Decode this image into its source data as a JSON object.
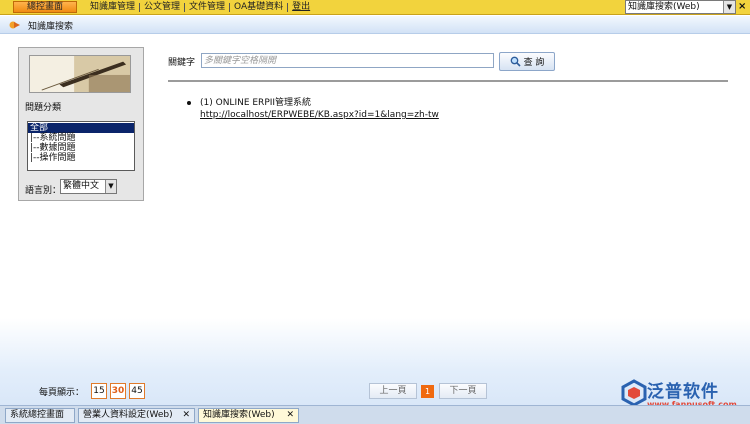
{
  "topbar": {
    "home_label": "總控畫面",
    "menu": [
      "知識庫管理",
      "公文管理",
      "文件管理",
      "OA基礎資料"
    ],
    "logout_label": "登出",
    "module_select_value": "知識庫搜索(Web)",
    "close_symbol": "×"
  },
  "header": {
    "title": "知識庫搜索"
  },
  "left_panel": {
    "category_label": "問題分類",
    "categories": [
      "全部",
      "|--系統問題",
      "|--數據問題",
      "|--操作問題"
    ],
    "selected_category": "全部",
    "language_label": "語言別：",
    "language_value": "繁體中文"
  },
  "search": {
    "keyword_label": "關鍵字",
    "placeholder": "多關鍵字空格隔開",
    "button_label": "查 詢"
  },
  "results": [
    {
      "title": "(1) ONLINE ERPII管理系統",
      "url": "http://localhost/ERPWEBE/KB.aspx?id=1&lang=zh-tw"
    }
  ],
  "pager": {
    "per_page_label": "每頁顯示：",
    "per_page_options": [
      "15",
      "30",
      "45"
    ],
    "selected_per_page": "30",
    "prev_label": "上一頁",
    "current_page": "1",
    "next_label": "下一頁"
  },
  "logo": {
    "text": "泛普软件",
    "url": "www.fanpusoft.com"
  },
  "tabs": [
    {
      "label": "系統總控畫面",
      "closable": false
    },
    {
      "label": "營業人資料設定(Web)",
      "closable": true
    },
    {
      "label": "知識庫搜索(Web)",
      "closable": true,
      "active": true
    }
  ],
  "colors": {
    "menu_bar": "#f2d33d",
    "accent_orange": "#f06a10",
    "logo_blue": "#2a62b0"
  }
}
